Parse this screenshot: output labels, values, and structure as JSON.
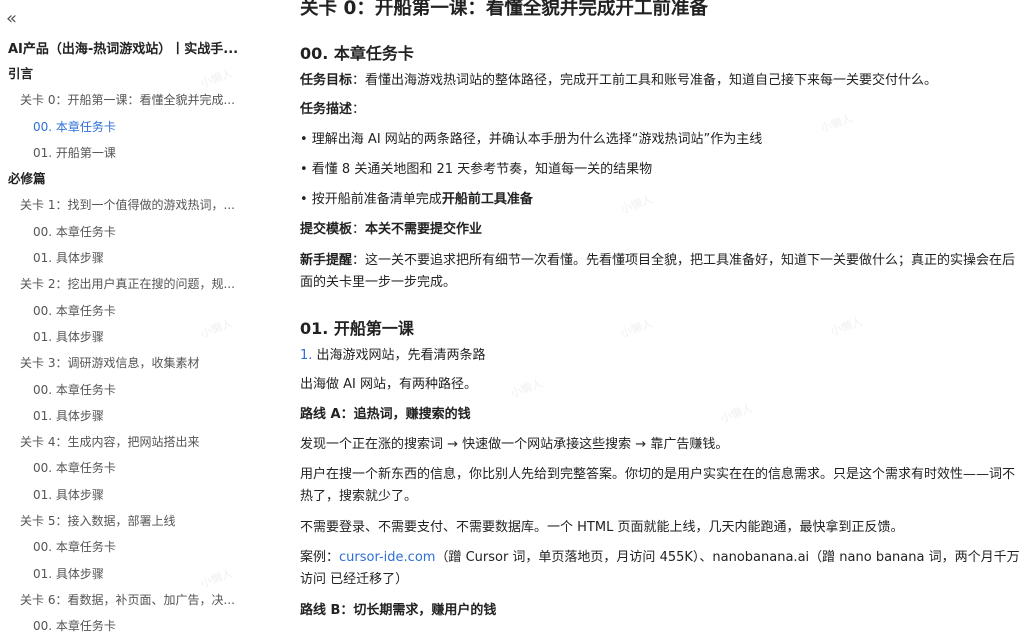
{
  "sidebar": {
    "collapse_icon": "«",
    "book_title": "AI产品（出海-热词游戏站）丨实战手...",
    "items": [
      {
        "label": "引言",
        "level": 0
      },
      {
        "label": "关卡 0：开船第一课：看懂全貌并完成...",
        "level": 1
      },
      {
        "label": "00. 本章任务卡",
        "level": 2,
        "active": true
      },
      {
        "label": "01. 开船第一课",
        "level": 2
      },
      {
        "label": "必修篇",
        "level": 0
      },
      {
        "label": "关卡 1：找到一个值得做的游戏热词，...",
        "level": 1
      },
      {
        "label": "00. 本章任务卡",
        "level": 2
      },
      {
        "label": "01. 具体步骤",
        "level": 2
      },
      {
        "label": "关卡 2：挖出用户真正在搜的问题，规...",
        "level": 1
      },
      {
        "label": "00. 本章任务卡",
        "level": 2
      },
      {
        "label": "01. 具体步骤",
        "level": 2
      },
      {
        "label": "关卡 3：调研游戏信息，收集素材",
        "level": 1
      },
      {
        "label": "00. 本章任务卡",
        "level": 2
      },
      {
        "label": "01. 具体步骤",
        "level": 2
      },
      {
        "label": "关卡 4：生成内容，把网站搭出来",
        "level": 1
      },
      {
        "label": "00. 本章任务卡",
        "level": 2
      },
      {
        "label": "01. 具体步骤",
        "level": 2
      },
      {
        "label": "关卡 5：接入数据，部署上线",
        "level": 1
      },
      {
        "label": "00. 本章任务卡",
        "level": 2
      },
      {
        "label": "01. 具体步骤",
        "level": 2
      },
      {
        "label": "关卡 6：看数据，补页面、加广告，决...",
        "level": 1
      },
      {
        "label": "00. 本章任务卡",
        "level": 2
      }
    ]
  },
  "main": {
    "page_title": "关卡 0：开船第一课：看懂全貌并完成开工前准备",
    "section1_title": "00. 本章任务卡",
    "goal_label": "任务目标",
    "goal_text": "：看懂出海游戏热词站的整体路径，完成开工前工具和账号准备，知道自己接下来每一关要交付什么。",
    "desc_label": "任务描述",
    "desc_colon": "：",
    "bullets": [
      {
        "text": "• 理解出海 AI 网站的两条路径，并确认本手册为什么选择“游戏热词站”作为主线",
        "bold": ""
      },
      {
        "text": "• 看懂 8 关通关地图和 21 天参考节奏，知道每一关的结果物",
        "bold": ""
      },
      {
        "text": "• 按开船前准备清单完成",
        "bold": "开船前工具准备"
      }
    ],
    "submit_label": "提交模板",
    "submit_colon": "：",
    "submit_value": "本关不需要提交作业",
    "tip_label": "新手提醒",
    "tip_text": "：这一关不要追求把所有细节一次看懂。先看懂项目全貌，把工具准备好，知道下一关要做什么；真正的实操会在后面的关卡里一步一步完成。",
    "section2_title": "01. 开船第一课",
    "step1_num": "1.",
    "step1_text": "出海游戏网站，先看清两条路",
    "intro_text": "出海做 AI 网站，有两种路径。",
    "routeA_title": "路线 A：追热词，赚搜索的钱",
    "routeA_flow": "发现一个正在涨的搜索词 → 快速做一个网站承接这些搜索 → 靠广告赚钱。",
    "routeA_desc": "用户在搜一个新东西的信息，你比别人先给到完整答案。你切的是用户实实在在的信息需求。只是这个需求有时效性——词不热了，搜索就少了。",
    "routeA_nodeps": "不需要登录、不需要支付、不需要数据库。一个 HTML 页面就能上线，几天内能跑通，最快拿到正反馈。",
    "case_prefix": "案例：",
    "case_link": "cursor-ide.com",
    "case_mid": "（蹭 Cursor 词，单页落地页，月访问 455K）、",
    "case_domain2": "nanobanana.ai",
    "case_suffix": "（蹭 nano banana 词，两个月千万访问 已经迁移了）",
    "routeB_title": "路线 B：切长期需求，赚用户的钱"
  },
  "watermark": "小懒人",
  "colors": {
    "accent": "#2f6fd6",
    "text": "#222222",
    "muted": "#555555"
  }
}
